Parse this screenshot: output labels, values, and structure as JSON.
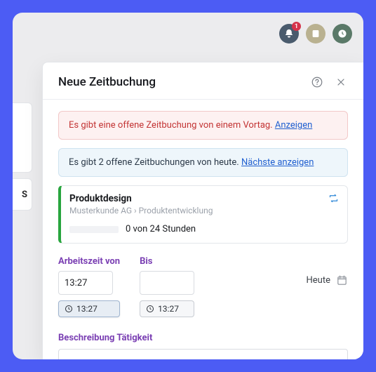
{
  "topbar": {
    "notification_badge": "1"
  },
  "stub_letter": "S",
  "modal": {
    "title": "Neue Zeitbuchung",
    "alert_error_text": "Es gibt eine offene Zeitbuchung von einem Vortag. ",
    "alert_error_link": "Anzeigen",
    "alert_info_text": "Es gibt 2 offene Zeitbuchungen von heute. ",
    "alert_info_link": "Nächste anzeigen",
    "task": {
      "title": "Produktdesign",
      "client": "Musterkunde AG",
      "path_sep": " › ",
      "project": "Produktentwicklung",
      "hours_text": "0 von 24 Stunden"
    },
    "time": {
      "from_label": "Arbeitszeit von",
      "to_label": "Bis",
      "from_value": "13:27",
      "to_value": "",
      "chip_from": "13:27",
      "chip_to": "13:27",
      "today_label": "Heute"
    },
    "desc_label": "Beschreibung Tätigkeit"
  }
}
